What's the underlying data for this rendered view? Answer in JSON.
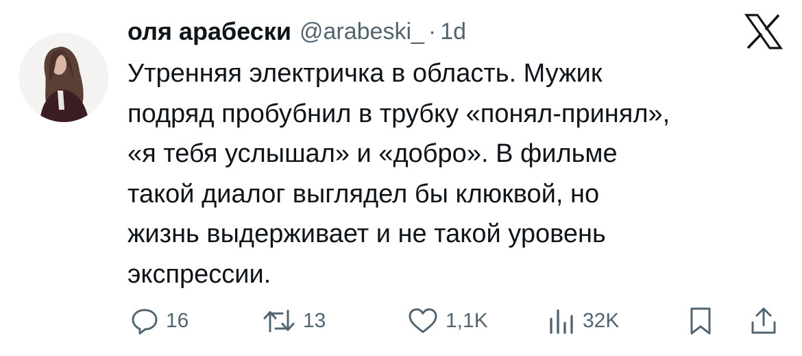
{
  "tweet": {
    "author": {
      "display_name": "оля арабески",
      "handle": "@arabeski_",
      "separator": "·",
      "time": "1d"
    },
    "platform_icon": "x-logo-icon",
    "text_lines": [
      "Утренняя электричка в область. Мужик",
      "подряд пробубнил в трубку «понял-принял»,",
      "«я тебя услышал» и «добро». В фильме",
      "такой диалог выглядел бы клюквой, но",
      "жизнь выдерживает и не такой уровень",
      "экспрессии."
    ],
    "actions": {
      "reply": {
        "icon": "reply-icon",
        "count": "16"
      },
      "retweet": {
        "icon": "retweet-icon",
        "count": "13"
      },
      "like": {
        "icon": "heart-icon",
        "count": "1,1K"
      },
      "views": {
        "icon": "views-chart-icon",
        "count": "32K"
      },
      "bookmark": {
        "icon": "bookmark-icon"
      },
      "share": {
        "icon": "share-icon"
      }
    },
    "colors": {
      "text": "#0f1419",
      "secondary": "#536471",
      "background": "#ffffff"
    }
  }
}
